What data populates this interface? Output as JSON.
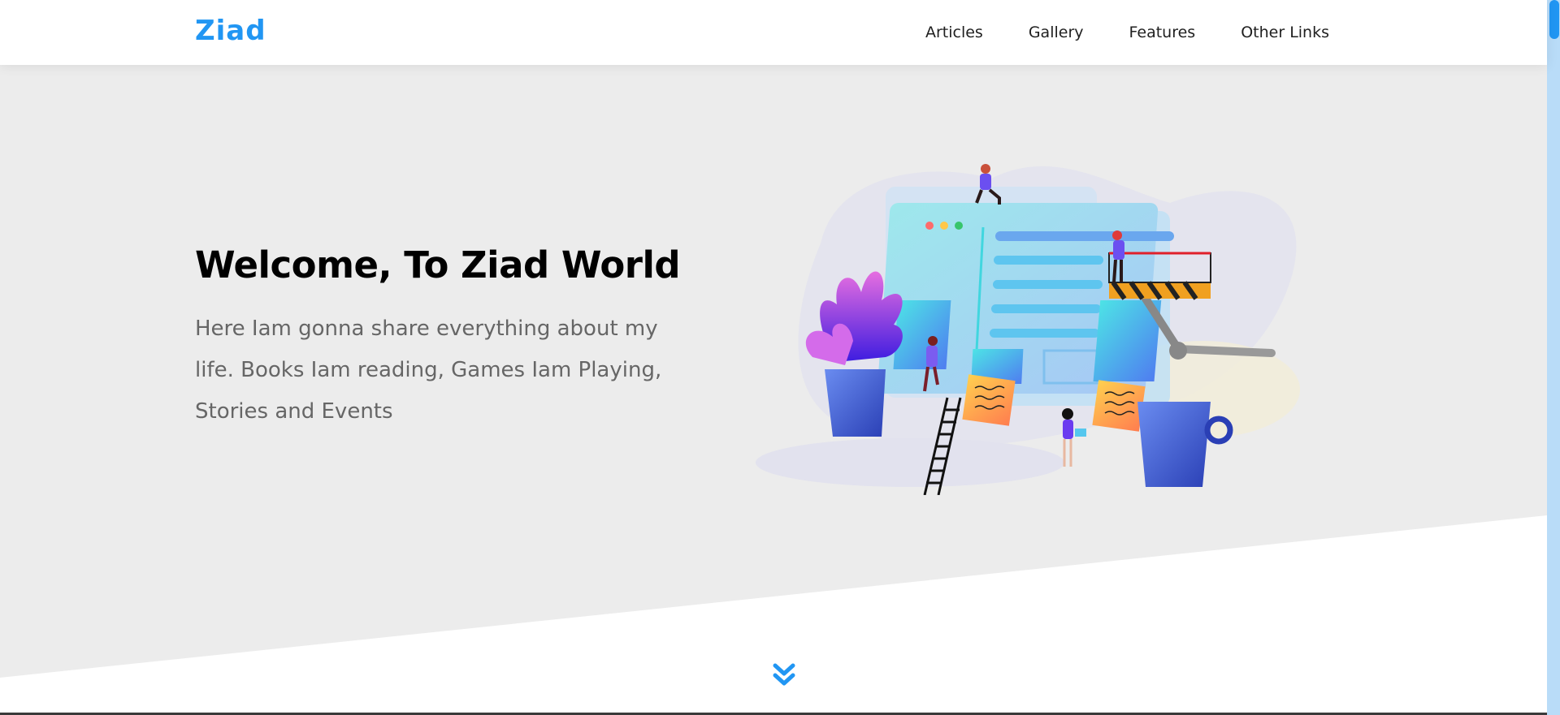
{
  "header": {
    "logo": "Ziad",
    "nav": [
      {
        "label": "Articles"
      },
      {
        "label": "Gallery"
      },
      {
        "label": "Features"
      },
      {
        "label": "Other Links"
      }
    ]
  },
  "hero": {
    "title": "Welcome, To Ziad World",
    "text": "Here Iam gonna share everything about my life. Books Iam reading, Games Iam Playing, Stories and Events"
  },
  "icons": {
    "scroll_down": "chevron-double-down-icon",
    "illustration": "team-building-website-illustration"
  },
  "colors": {
    "accent": "#2196f3",
    "hero_bg": "#ececec",
    "title": "#000000",
    "text": "#666666"
  }
}
